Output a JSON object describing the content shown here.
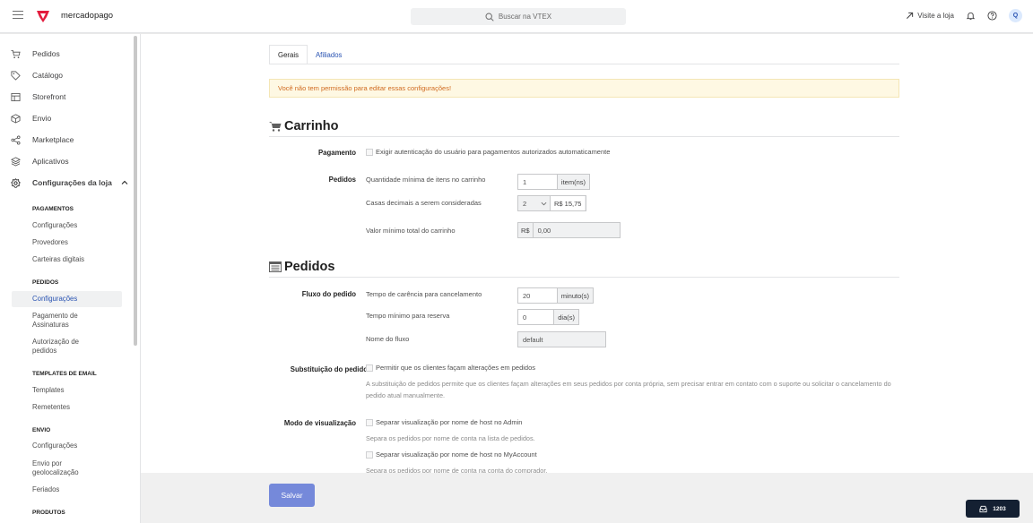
{
  "topbar": {
    "brand": "mercadopago",
    "search_placeholder": "Buscar na VTEX",
    "visit_store": "Visite a loja",
    "avatar_initial": "Q"
  },
  "sidebar": {
    "main_items": [
      {
        "label": "Pedidos",
        "icon": "cart-icon"
      },
      {
        "label": "Catálogo",
        "icon": "tag-icon"
      },
      {
        "label": "Storefront",
        "icon": "layout-icon"
      },
      {
        "label": "Envio",
        "icon": "box-icon"
      },
      {
        "label": "Marketplace",
        "icon": "share-icon"
      },
      {
        "label": "Aplicativos",
        "icon": "layers-icon"
      },
      {
        "label": "Configurações da loja",
        "icon": "gear-icon"
      }
    ],
    "sub": {
      "pagamentos_head": "PAGAMENTOS",
      "pag_config": "Configurações",
      "provedores": "Provedores",
      "carteiras": "Carteiras digitais",
      "pedidos_head": "PEDIDOS",
      "ped_config": "Configurações",
      "assinaturas": "Pagamento de Assinaturas",
      "autorizacao": "Autorização de pedidos",
      "email_head": "TEMPLATES DE EMAIL",
      "templates": "Templates",
      "remetentes": "Remetentes",
      "envio_head": "ENVIO",
      "env_config": "Configurações",
      "geoloc": "Envio por geolocalização",
      "feriados": "Feriados",
      "produtos_head": "PRODUTOS"
    }
  },
  "tabs": {
    "gerais": "Gerais",
    "afiliados": "Afiliados"
  },
  "alert": "Você não tem permissão para editar essas configurações!",
  "carrinho": {
    "title": "Carrinho",
    "pagamento_label": "Pagamento",
    "pagamento_check": "Exigir autenticação do usuário para pagamentos autorizados automaticamente",
    "pedidos_label": "Pedidos",
    "qtd_min_label": "Quantidade mínima de itens no carrinho",
    "qtd_min_value": "1",
    "qtd_min_suffix": "item(ns)",
    "casas_label": "Casas decimais a serem consideradas",
    "casas_value": "2",
    "casas_example": "R$ 15,75",
    "valor_min_label": "Valor mínimo total do carrinho",
    "valor_prefix": "R$",
    "valor_value": "0,00"
  },
  "pedidos": {
    "title": "Pedidos",
    "fluxo_label": "Fluxo do pedido",
    "carencia_label": "Tempo de carência para cancelamento",
    "carencia_value": "20",
    "carencia_suffix": "minuto(s)",
    "reserva_label": "Tempo mínimo para reserva",
    "reserva_value": "0",
    "reserva_suffix": "dia(s)",
    "nome_fluxo_label": "Nome do fluxo",
    "nome_fluxo_value": "default",
    "subst_label": "Substituição do pedido",
    "subst_check": "Permitir que os clientes façam alterações em pedidos",
    "subst_help": "A substituição de pedidos permite que os clientes façam alterações em seus pedidos por conta própria, sem precisar entrar em contato com o suporte ou solicitar o cancelamento do pedido atual manualmente.",
    "modo_label": "Modo de visualização",
    "admin_check": "Separar visualização por nome de host no Admin",
    "admin_help": "Separa os pedidos por nome de conta na lista de pedidos.",
    "myaccount_check": "Separar visualização por nome de host no MyAccount",
    "myaccount_help": "Separa os pedidos por nome de conta na conta do comprador."
  },
  "footer": {
    "save": "Salvar"
  },
  "badge": {
    "count": "1203"
  }
}
